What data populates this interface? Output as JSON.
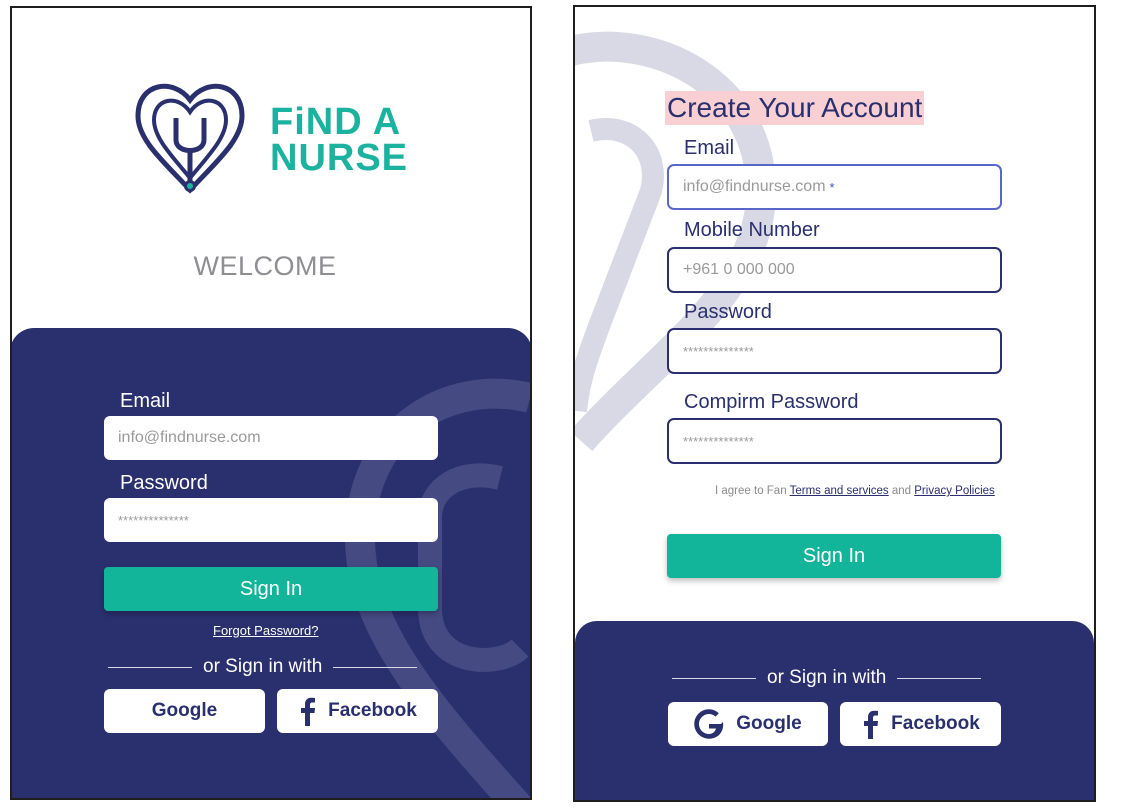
{
  "login": {
    "brand_line1": "FiND A",
    "brand_line2": "NURSE",
    "welcome": "WELCOME",
    "email_label": "Email",
    "email_placeholder": "info@findnurse.com",
    "password_label": "Password",
    "password_placeholder": "**************",
    "signin_label": "Sign In",
    "forgot_label": "Forgot Password?",
    "or_label": "or Sign in with",
    "google_label": "Google",
    "facebook_label": "Facebook"
  },
  "signup": {
    "title": "Create Your Account",
    "email_label": "Email",
    "email_placeholder": "info@findnurse.com",
    "email_required_mark": "*",
    "mobile_label": "Mobile Number",
    "mobile_placeholder": "+961 0 000 000",
    "password_label": "Password",
    "password_placeholder": "**************",
    "confirm_label": "Compirm Password",
    "confirm_placeholder": "**************",
    "agree_prefix": "I agree to Fan",
    "terms_link": "Terms and services",
    "agree_and": "and",
    "privacy_link": "Privacy Policies",
    "signin_label": "Sign In",
    "or_label": "or Sign in with",
    "google_label": "Google",
    "facebook_label": "Facebook"
  },
  "colors": {
    "navy": "#2a2f6e",
    "teal": "#12b49a",
    "brand_teal": "#1bb29f",
    "title_highlight": "#f8cfd2"
  },
  "icons": [
    "stethoscope-heart-logo-icon",
    "google-icon",
    "facebook-icon"
  ]
}
